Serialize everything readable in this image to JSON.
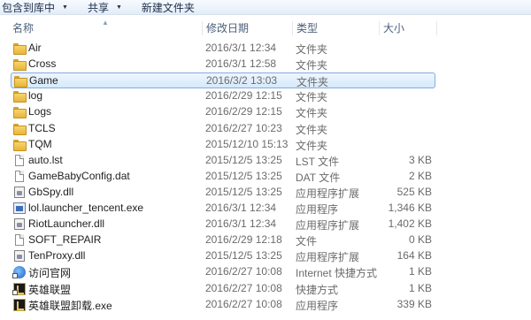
{
  "toolbar": {
    "include_library": "包含到库中",
    "share": "共享",
    "new_folder": "新建文件夹"
  },
  "columns": {
    "name": "名称",
    "date": "修改日期",
    "type": "类型",
    "size": "大小"
  },
  "files": [
    {
      "name": "Air",
      "date": "2016/3/1 12:34",
      "type": "文件夹",
      "size": "",
      "icon": "folder-icon",
      "selected": false
    },
    {
      "name": "Cross",
      "date": "2016/3/1 12:58",
      "type": "文件夹",
      "size": "",
      "icon": "folder-icon",
      "selected": false
    },
    {
      "name": "Game",
      "date": "2016/3/2 13:03",
      "type": "文件夹",
      "size": "",
      "icon": "folder-icon",
      "selected": true
    },
    {
      "name": "log",
      "date": "2016/2/29 12:15",
      "type": "文件夹",
      "size": "",
      "icon": "folder-icon",
      "selected": false
    },
    {
      "name": "Logs",
      "date": "2016/2/29 12:15",
      "type": "文件夹",
      "size": "",
      "icon": "folder-icon",
      "selected": false
    },
    {
      "name": "TCLS",
      "date": "2016/2/27 10:23",
      "type": "文件夹",
      "size": "",
      "icon": "folder-icon",
      "selected": false
    },
    {
      "name": "TQM",
      "date": "2015/12/10 15:13",
      "type": "文件夹",
      "size": "",
      "icon": "folder-icon",
      "selected": false
    },
    {
      "name": "auto.lst",
      "date": "2015/12/5 13:25",
      "type": "LST 文件",
      "size": "3 KB",
      "icon": "file-icon",
      "selected": false
    },
    {
      "name": "GameBabyConfig.dat",
      "date": "2015/12/5 13:25",
      "type": "DAT 文件",
      "size": "2 KB",
      "icon": "file-icon",
      "selected": false
    },
    {
      "name": "GbSpy.dll",
      "date": "2015/12/5 13:25",
      "type": "应用程序扩展",
      "size": "525 KB",
      "icon": "dll-icon",
      "selected": false
    },
    {
      "name": "lol.launcher_tencent.exe",
      "date": "2016/3/1 12:34",
      "type": "应用程序",
      "size": "1,346 KB",
      "icon": "exe-icon",
      "selected": false
    },
    {
      "name": "RiotLauncher.dll",
      "date": "2016/3/1 12:34",
      "type": "应用程序扩展",
      "size": "1,402 KB",
      "icon": "dll-icon",
      "selected": false
    },
    {
      "name": "SOFT_REPAIR",
      "date": "2016/2/29 12:18",
      "type": "文件",
      "size": "0 KB",
      "icon": "file-icon",
      "selected": false
    },
    {
      "name": "TenProxy.dll",
      "date": "2015/12/5 13:25",
      "type": "应用程序扩展",
      "size": "164 KB",
      "icon": "dll-icon",
      "selected": false
    },
    {
      "name": "访问官网",
      "date": "2016/2/27 10:08",
      "type": "Internet 快捷方式",
      "size": "1 KB",
      "icon": "internet-shortcut-icon",
      "selected": false
    },
    {
      "name": "英雄联盟",
      "date": "2016/2/27 10:08",
      "type": "快捷方式",
      "size": "1 KB",
      "icon": "lol-shortcut-icon",
      "selected": false
    },
    {
      "name": "英雄联盟卸载.exe",
      "date": "2016/2/27 10:08",
      "type": "应用程序",
      "size": "339 KB",
      "icon": "lol-uninstall-icon",
      "selected": false
    }
  ]
}
